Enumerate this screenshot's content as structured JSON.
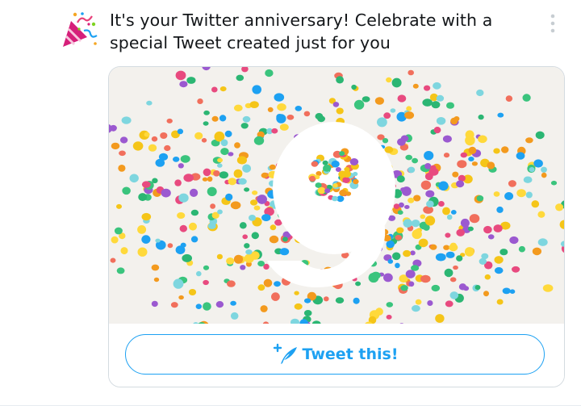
{
  "notification": {
    "icon": "party-popper-icon",
    "message": "It's your Twitter anniversary! Celebrate with a special Tweet created just for you",
    "more_icon": "more-vertical-icon"
  },
  "card": {
    "image": {
      "description_icon": "confetti-anniversary-image",
      "numeral": "9"
    },
    "button": {
      "label": "Tweet this!",
      "icon": "compose-quill-icon",
      "color": "#1da1f2"
    }
  },
  "colors": {
    "accent": "#1da1f2",
    "text": "#14171a",
    "border": "#d4dbe0"
  }
}
